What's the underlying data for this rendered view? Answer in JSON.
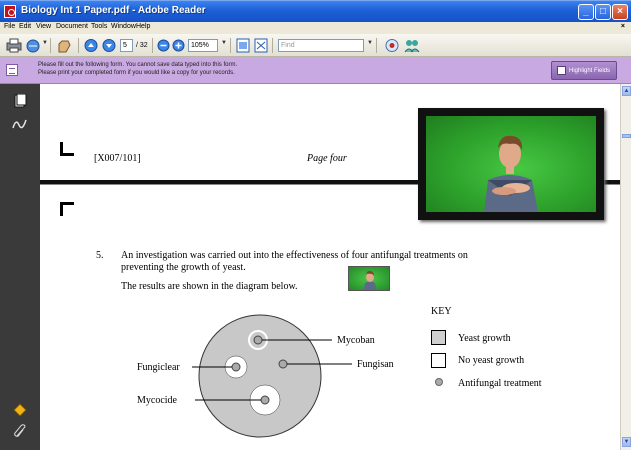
{
  "window": {
    "title": "Biology Int 1 Paper.pdf - Adobe Reader",
    "controls": {
      "minimize": "_",
      "maximize": "□",
      "close": "×"
    }
  },
  "menu": {
    "items": [
      "File",
      "Edit",
      "View",
      "Document",
      "Tools",
      "Window",
      "Help"
    ],
    "close_doc": "×"
  },
  "toolbar": {
    "page_current": "5",
    "page_total": "/ 32",
    "zoom": "105%",
    "find_placeholder": "Find"
  },
  "forms_bar": {
    "message_line1": "Please fill out the following form. You cannot save data typed into this form.",
    "message_line2": "Please print your completed form if you would like a copy for your records.",
    "highlight_button": "Highlight Fields"
  },
  "document": {
    "code": "[X007/101]",
    "page_label": "Page four",
    "question_number": "5.",
    "question_line1": "An investigation was carried out into the effectiveness of four antifungal treatments on",
    "question_line2": "preventing the growth of yeast.",
    "question_line3": "The results are shown in the diagram below.",
    "diagram_labels": {
      "mycoban": "Mycoban",
      "fungisan": "Fungisan",
      "fungiclear": "Fungiclear",
      "mycocide": "Mycocide"
    },
    "key": {
      "title": "KEY",
      "yeast_growth": "Yeast growth",
      "no_yeast_growth": "No yeast growth",
      "antifungal_treatment": "Antifungal treatment"
    }
  },
  "colors": {
    "titlebar": "#1d5fd6",
    "forms_bar": "#c9a9e1",
    "sidebar": "#3a3a3a",
    "green_screen": "#2da12b",
    "dish_grey": "#c8c8c8"
  }
}
